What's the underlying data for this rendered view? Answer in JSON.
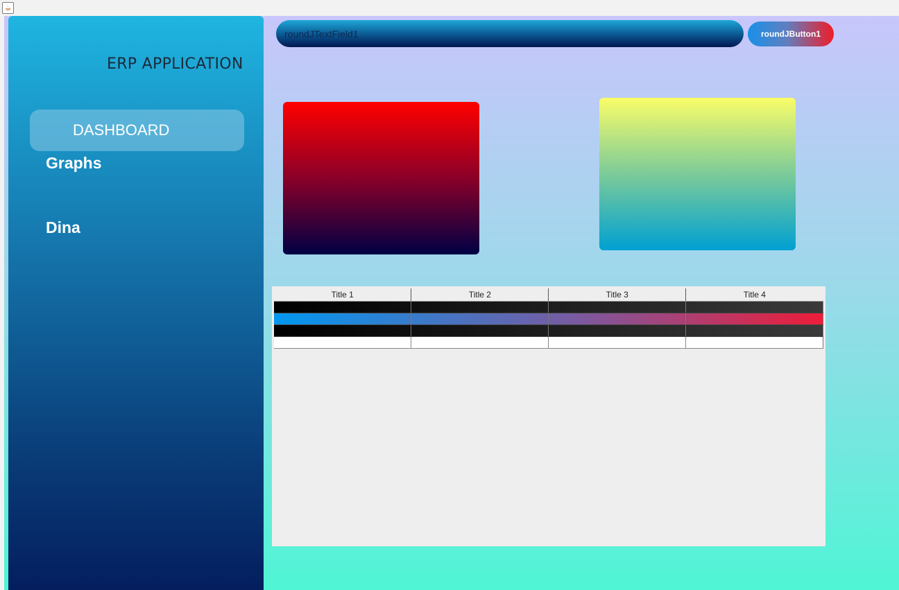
{
  "window": {
    "icon": "java-icon"
  },
  "sidebar": {
    "app_title": "ERP APPLICATION",
    "items": [
      {
        "label": "DASHBOARD",
        "active": true
      },
      {
        "label": "Graphs"
      },
      {
        "label": "Dina"
      }
    ]
  },
  "header": {
    "text_field_placeholder": "roundJTextField1",
    "button_label": "roundJButton1"
  },
  "table": {
    "columns": [
      "Title 1",
      "Title 2",
      "Title 3",
      "Title 4"
    ],
    "rows": [
      [
        "",
        "",
        "",
        ""
      ],
      [
        "",
        "",
        "",
        ""
      ],
      [
        "",
        "",
        "",
        ""
      ],
      [
        "",
        "",
        "",
        ""
      ]
    ],
    "selected_row": 2
  },
  "colors": {
    "sidebar_top": "#1fb5e1",
    "sidebar_bottom": "#041e5e",
    "card1_top": "#ff0000",
    "card1_bottom": "#000044",
    "card2_top": "#fafd68",
    "card2_bottom": "#00a0d2",
    "background_top": "#c8c6fb",
    "background_bottom": "#4ff5d5"
  }
}
